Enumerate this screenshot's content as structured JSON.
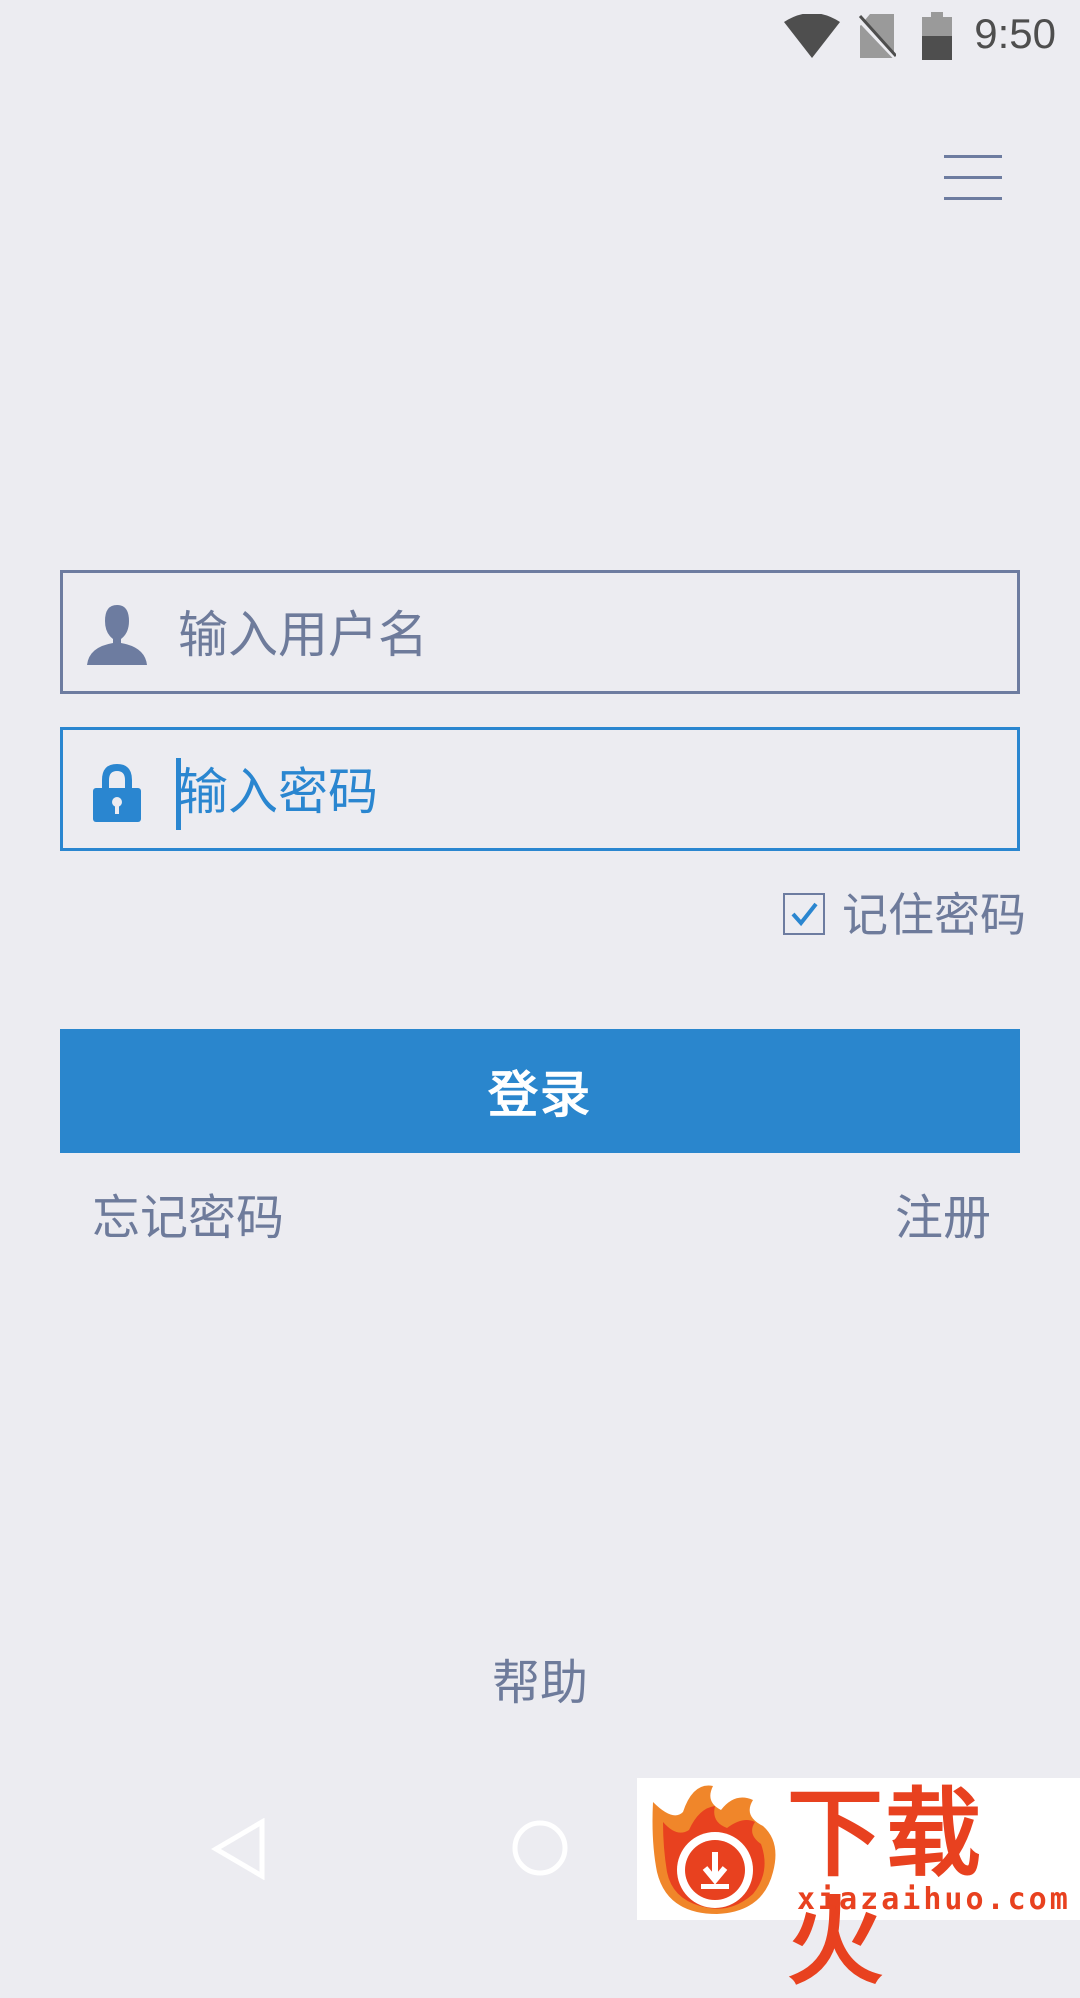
{
  "status_bar": {
    "time": "9:50",
    "icons": [
      "wifi-icon",
      "no-sim-icon",
      "battery-icon"
    ]
  },
  "menu": {
    "icon": "hamburger-menu-icon"
  },
  "login_form": {
    "username": {
      "placeholder": "输入用户名",
      "icon": "user-icon"
    },
    "password": {
      "placeholder": "输入密码",
      "icon": "lock-icon",
      "focused": true
    },
    "remember": {
      "label": "记住密码",
      "checked": true
    },
    "submit_label": "登录",
    "forgot_label": "忘记密码",
    "register_label": "注册"
  },
  "footer": {
    "help_label": "帮助"
  },
  "watermark": {
    "brand": "下载火",
    "domain": "xiazaihuo.com"
  },
  "colors": {
    "background": "#ececf1",
    "accent": "#2a86cd",
    "text": "#6e7b9b",
    "watermark": "#e8411f"
  }
}
